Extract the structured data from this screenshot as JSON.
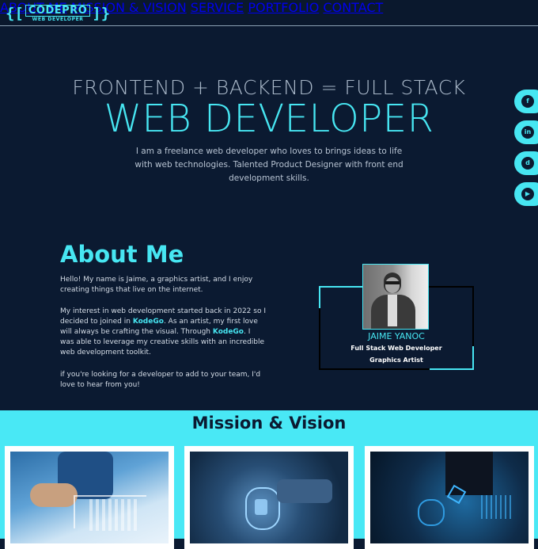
{
  "colors": {
    "accent": "#47e6f2",
    "background": "#0b1a31",
    "mission_bg": "#49e8f5"
  },
  "logo": {
    "left_bracket": "{[",
    "name": "CODEPRO",
    "tagline": "WEB DEVELOPER",
    "right_bracket": "]}"
  },
  "nav": {
    "items": [
      "ABOUT ME",
      "MISSION & VISION",
      "SERVICE",
      "PORTFOLIO",
      "CONTACT"
    ]
  },
  "hero": {
    "line1": "FRONTEND + BACKEND = FULL STACK",
    "line2": "WEB DEVELOPER",
    "description": "I am a freelance web developer who loves to brings ideas to life with web technologies. Talented Product Designer with front end development skills."
  },
  "social": [
    {
      "icon": "facebook-icon",
      "glyph": "f"
    },
    {
      "icon": "linkedin-icon",
      "glyph": "in"
    },
    {
      "icon": "discord-icon",
      "glyph": "d"
    },
    {
      "icon": "youtube-icon",
      "glyph": "▶"
    }
  ],
  "about": {
    "title": "About Me",
    "p1": "Hello! My name is Jaime, a graphics artist, and I enjoy creating things that live on the internet.",
    "p2_a": "My interest in web development started back in 2022 so I decided to joined in ",
    "brand": "KodeGo",
    "p2_b": ". As an artist, my first love will always be crafting the visual. Through ",
    "p2_c": ". I was able to leverage my creative skills with an incredible web development toolkit.",
    "p3": "if you're looking for a developer to add to your team, I'd love to hear from you!"
  },
  "profile": {
    "name": "JAIME YANOC",
    "role1": "Full Stack Web Developer",
    "role2": "Graphics Artist"
  },
  "mission": {
    "title": "Mission & Vision"
  }
}
